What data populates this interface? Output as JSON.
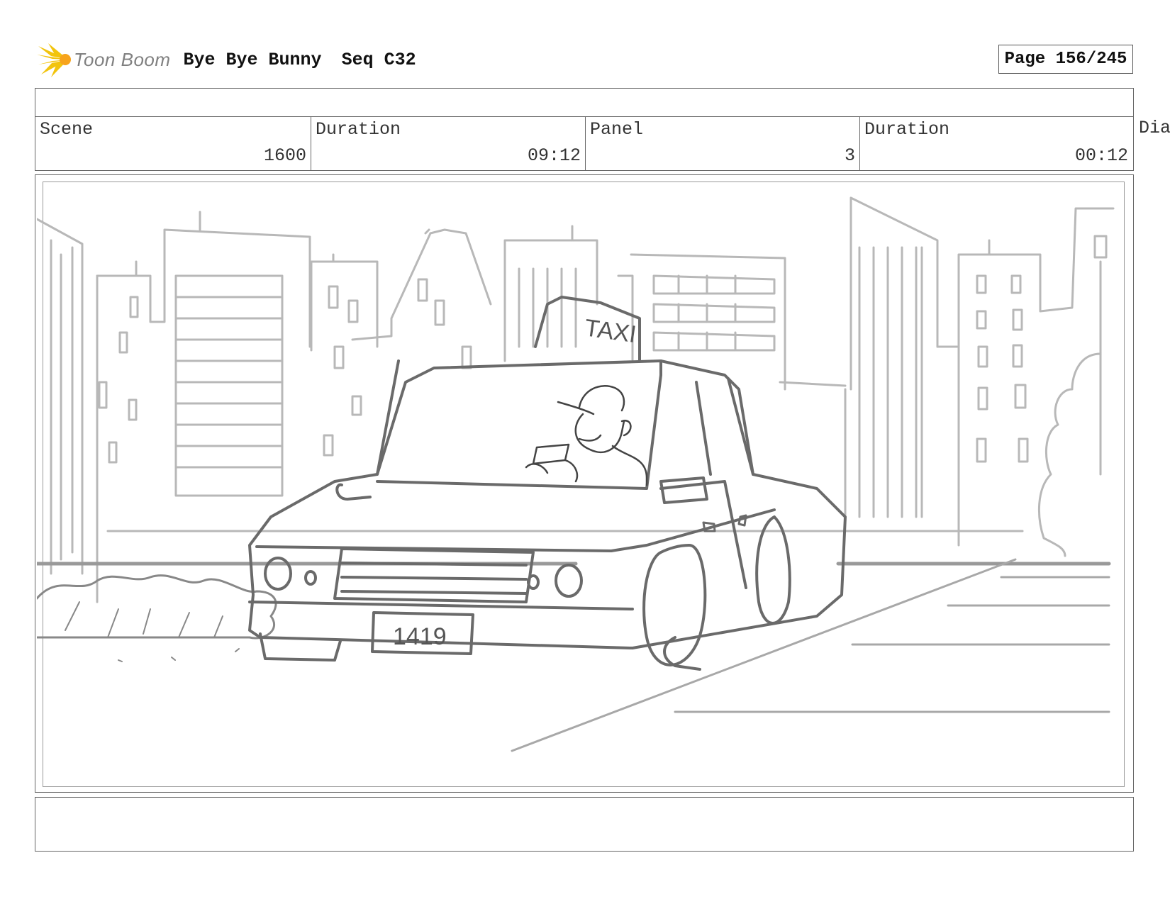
{
  "header": {
    "logo_text": "Toon Boom",
    "project_title": "Bye Bye Bunny",
    "sequence": "Seq C32",
    "page": "Page 156/245"
  },
  "info": {
    "scene_label": "Scene",
    "scene_value": "1600",
    "scene_duration_label": "Duration",
    "scene_duration_value": "09:12",
    "panel_label": "Panel",
    "panel_value": "3",
    "panel_duration_label": "Duration",
    "panel_duration_value": "00:12",
    "dialogue_label": "Dia"
  },
  "drawing": {
    "taxi_sign": "TAXI",
    "license_plate": "1419"
  }
}
